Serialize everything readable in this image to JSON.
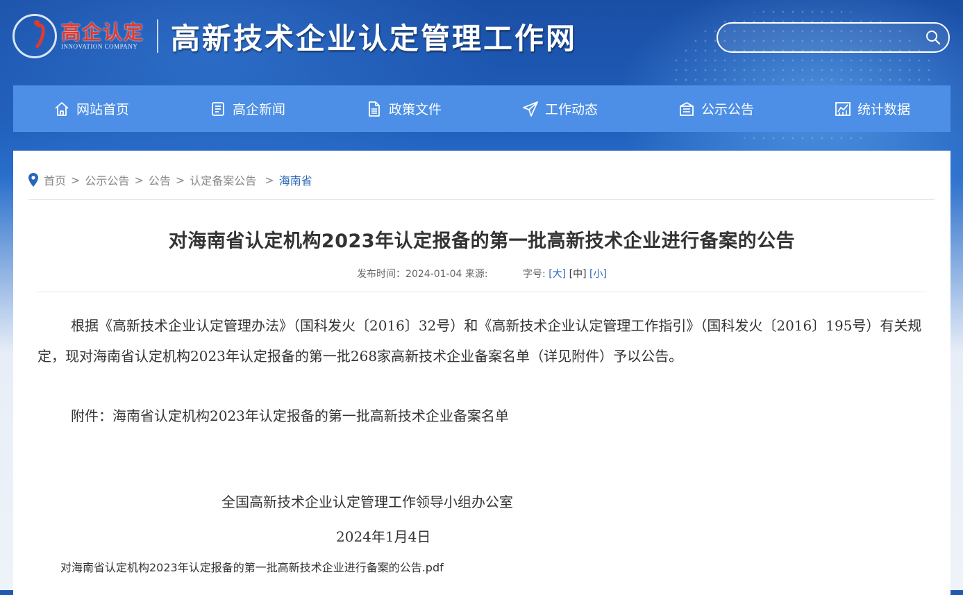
{
  "header": {
    "logo_cn": "高企认定",
    "logo_en": "INNOVATION COMPANY",
    "site_title": "高新技术企业认定管理工作网",
    "search_placeholder": ""
  },
  "nav": {
    "items": [
      {
        "label": "网站首页",
        "icon": "home-icon"
      },
      {
        "label": "高企新闻",
        "icon": "news-icon"
      },
      {
        "label": "政策文件",
        "icon": "document-icon"
      },
      {
        "label": "工作动态",
        "icon": "paper-plane-icon"
      },
      {
        "label": "公示公告",
        "icon": "bulletin-icon"
      },
      {
        "label": "统计数据",
        "icon": "chart-icon"
      }
    ]
  },
  "breadcrumb": {
    "items": [
      "首页",
      "公示公告",
      "公告",
      "认定备案公告",
      "海南省"
    ],
    "separator": ">"
  },
  "article": {
    "title": "对海南省认定机构2023年认定报备的第一批高新技术企业进行备案的公告",
    "meta_publish": "发布时间：2024-01-04 来源:",
    "meta_fontsize_label": "字号:",
    "font_large": "[大]",
    "font_medium": "[中]",
    "font_small": "[小]",
    "paragraph1": "根据《高新技术企业认定管理办法》（国科发火〔2016〕32号）和《高新技术企业认定管理工作指引》（国科发火〔2016〕195号）有关规定，现对海南省认定机构2023年认定报备的第一批268家高新技术企业备案名单（详见附件）予以公告。",
    "attachment": "附件：海南省认定机构2023年认定报备的第一批高新技术企业备案名单",
    "sign_org": "全国高新技术企业认定管理工作领导小组办公室",
    "sign_date": "2024年1月4日",
    "pdf_link": "对海南省认定机构2023年认定报备的第一批高新技术企业进行备案的公告.pdf"
  },
  "colors": {
    "nav_bg": "#4d8fe6",
    "link_blue": "#2866b8",
    "logo_red": "#e03a2f",
    "text": "#333333"
  }
}
